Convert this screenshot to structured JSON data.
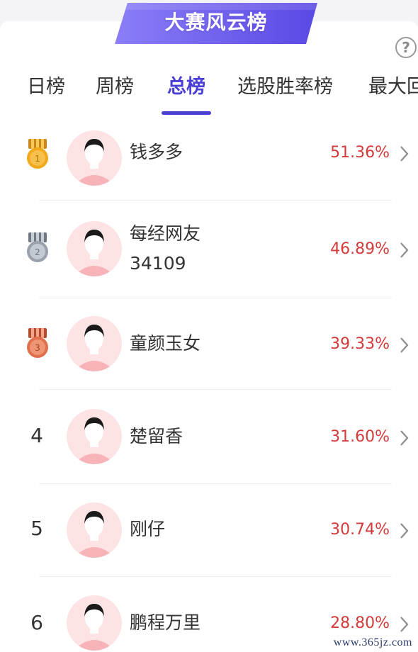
{
  "banner": {
    "title": "大赛风云榜"
  },
  "help": {
    "label": "?"
  },
  "tabs": [
    {
      "label": "日榜"
    },
    {
      "label": "周榜"
    },
    {
      "label": "总榜"
    },
    {
      "label": "选股胜率榜"
    },
    {
      "label": "最大回"
    }
  ],
  "active_tab": "总榜",
  "rows": [
    {
      "rank": "1",
      "medal": "gold-medal-icon",
      "name": "钱多多",
      "pct": "51.36%"
    },
    {
      "rank": "2",
      "medal": "silver-medal-icon",
      "name": "每经网友",
      "name2": "34109",
      "pct": "46.89%"
    },
    {
      "rank": "3",
      "medal": "bronze-medal-icon",
      "name": "童颜玉女",
      "pct": "39.33%"
    },
    {
      "rank": "4",
      "name": "楚留香",
      "pct": "31.60%"
    },
    {
      "rank": "5",
      "name": "刚仔",
      "pct": "30.74%"
    },
    {
      "rank": "6",
      "name": "鹏程万里",
      "pct": "28.80%"
    }
  ],
  "colors": {
    "accent": "#4b3fd6",
    "banner_gradient": [
      "#8a7cf5",
      "#5b4be6"
    ],
    "positive": "#d33a3a",
    "gold": "#f1a81c",
    "silver": "#9aa1ab",
    "bronze": "#e0704d"
  },
  "watermark": "www.365jz.com"
}
